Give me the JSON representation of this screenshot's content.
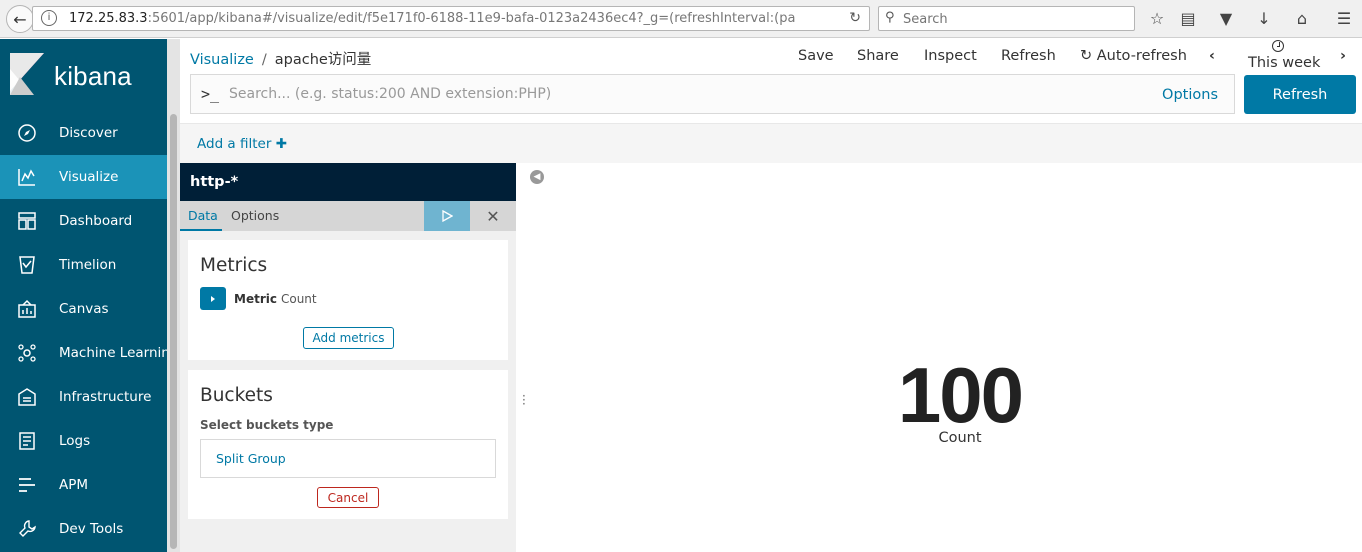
{
  "browser": {
    "url_host": "172.25.83.3",
    "url_rest": ":5601/app/kibana#/visualize/edit/f5e171f0-6188-11e9-bafa-0123a2436ec4?_g=(refreshInterval:(pa",
    "search_placeholder": "Search"
  },
  "app": {
    "logo_text": "kibana"
  },
  "sidebar": {
    "items": [
      {
        "label": "Discover",
        "icon": "compass-icon"
      },
      {
        "label": "Visualize",
        "icon": "chart-icon"
      },
      {
        "label": "Dashboard",
        "icon": "dashboard-icon"
      },
      {
        "label": "Timelion",
        "icon": "timelion-icon"
      },
      {
        "label": "Canvas",
        "icon": "canvas-icon"
      },
      {
        "label": "Machine Learning",
        "icon": "ml-icon"
      },
      {
        "label": "Infrastructure",
        "icon": "infrastructure-icon"
      },
      {
        "label": "Logs",
        "icon": "logs-icon"
      },
      {
        "label": "APM",
        "icon": "apm-icon"
      },
      {
        "label": "Dev Tools",
        "icon": "wrench-icon"
      }
    ],
    "active": "Visualize"
  },
  "header": {
    "breadcrumb_root": "Visualize",
    "breadcrumb_sep": "/",
    "breadcrumb_current": "apache访问量",
    "menu": {
      "save": "Save",
      "share": "Share",
      "inspect": "Inspect",
      "refresh": "Refresh",
      "auto_refresh": "Auto-refresh",
      "time_range": "This week"
    }
  },
  "query": {
    "prompt": ">_",
    "placeholder": "Search... (e.g. status:200 AND extension:PHP)",
    "options_label": "Options",
    "refresh_button": "Refresh"
  },
  "filter": {
    "add_filter": "Add a filter"
  },
  "editor": {
    "index_pattern": "http-*",
    "tabs": [
      "Data",
      "Options"
    ],
    "metrics_title": "Metrics",
    "metric_agg_label": "Metric",
    "metric_agg_value": "Count",
    "add_metrics": "Add metrics",
    "buckets_title": "Buckets",
    "select_buckets_type": "Select buckets type",
    "split_group": "Split Group",
    "cancel": "Cancel"
  },
  "visualization": {
    "value": "100",
    "label": "Count"
  },
  "colors": {
    "sidebar": "#005571",
    "sidebar_active": "#1b93b8",
    "accent": "#0079a5",
    "index_header": "#001f37",
    "danger": "#bd271e"
  }
}
